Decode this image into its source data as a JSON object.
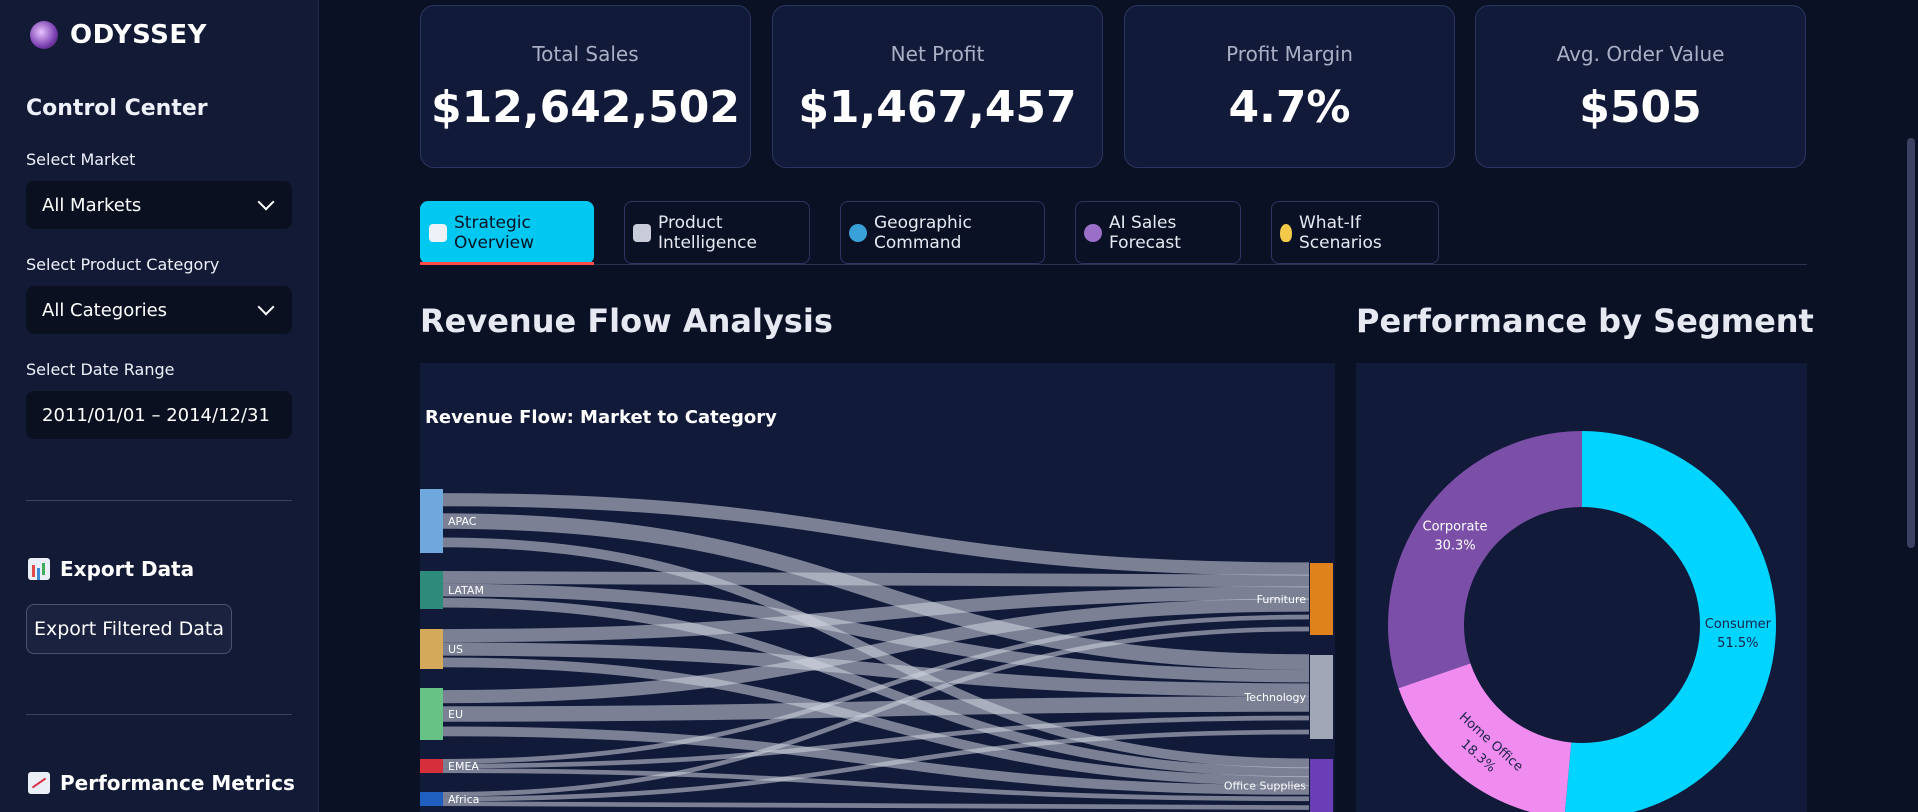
{
  "app": {
    "name": "ODYSSEY"
  },
  "sidebar": {
    "title": "Control Center",
    "market": {
      "label": "Select Market",
      "value": "All Markets"
    },
    "category": {
      "label": "Select Product Category",
      "value": "All Categories"
    },
    "date_range": {
      "label": "Select Date Range",
      "value": "2011/01/01 – 2014/12/31"
    },
    "export": {
      "heading": "Export Data",
      "button": "Export Filtered Data"
    },
    "metrics_heading": "Performance Metrics"
  },
  "kpis": [
    {
      "label": "Total Sales",
      "value": "$12,642,502"
    },
    {
      "label": "Net Profit",
      "value": "$1,467,457"
    },
    {
      "label": "Profit Margin",
      "value": "4.7%"
    },
    {
      "label": "Avg. Order Value",
      "value": "$505"
    }
  ],
  "tabs": [
    {
      "label": "Strategic Overview",
      "icon": "chart-up-icon",
      "active": true
    },
    {
      "label": "Product Intelligence",
      "icon": "microscope-icon",
      "active": false
    },
    {
      "label": "Geographic Command",
      "icon": "globe-icon",
      "active": false
    },
    {
      "label": "AI Sales Forecast",
      "icon": "crystal-ball-icon",
      "active": false
    },
    {
      "label": "What-If Scenarios",
      "icon": "lightbulb-icon",
      "active": false
    }
  ],
  "sections": {
    "revenue_flow": "Revenue Flow Analysis",
    "segment": "Performance by Segment"
  },
  "colors": {
    "accent": "#00c8f0",
    "tab_underline": "#ff4b4b",
    "panel_bg": "#121a3a",
    "sidebar_bg": "#131a36"
  },
  "chart_data": [
    {
      "type": "sankey",
      "title": "Revenue Flow: Market to Category",
      "sources": [
        {
          "name": "APAC",
          "color": "#6fa8dc"
        },
        {
          "name": "LATAM",
          "color": "#2e8b7a"
        },
        {
          "name": "US",
          "color": "#d4a95a"
        },
        {
          "name": "EU",
          "color": "#66c285"
        },
        {
          "name": "EMEA",
          "color": "#d62e3a"
        },
        {
          "name": "Africa",
          "color": "#1f5fbf"
        }
      ],
      "targets": [
        {
          "name": "Furniture",
          "color": "#e0821c"
        },
        {
          "name": "Technology",
          "color": "#a2a7b8"
        },
        {
          "name": "Office Supplies",
          "color": "#6a3fb5"
        }
      ]
    },
    {
      "type": "pie",
      "hole": true,
      "slices": [
        {
          "label": "Consumer",
          "value": 51.5,
          "color": "#00d4ff"
        },
        {
          "label": "Home Office",
          "value": 18.3,
          "color": "#f08cf0"
        },
        {
          "label": "Corporate",
          "value": 30.3,
          "color": "#7b4fa8"
        }
      ]
    }
  ]
}
